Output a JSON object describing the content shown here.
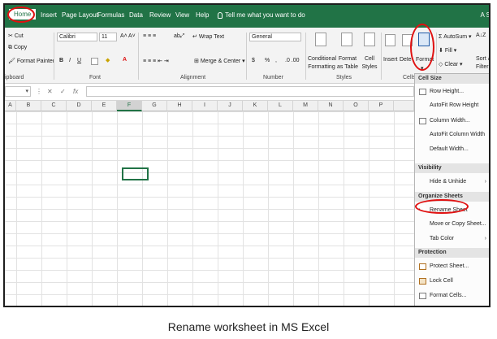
{
  "tabs": [
    {
      "label": "Home"
    },
    {
      "label": "Insert"
    },
    {
      "label": "Page Layout"
    },
    {
      "label": "Formulas"
    },
    {
      "label": "Data"
    },
    {
      "label": "Review"
    },
    {
      "label": "View"
    },
    {
      "label": "Help"
    }
  ],
  "tell_me": "Tell me what you want to do",
  "user": "A S",
  "clipboard": {
    "cut": "Cut",
    "copy": "Copy",
    "format_painter": "Format Painter",
    "group": "ipboard"
  },
  "font": {
    "name": "Calibri",
    "size": "11",
    "inc": "A˄",
    "dec": "A˅",
    "bold": "B",
    "italic": "I",
    "underline": "U",
    "group": "Font"
  },
  "alignment": {
    "wrap": "Wrap Text",
    "merge": "Merge & Center",
    "group": "Alignment"
  },
  "number": {
    "format": "General",
    "currency": "$",
    "percent": "%",
    "comma": ",",
    "group": "Number"
  },
  "styles": {
    "conditional": "Conditional Formatting",
    "format_as_table": "Format as Table",
    "cell_styles": "Cell Styles",
    "group": "Styles"
  },
  "cells": {
    "insert": "Insert",
    "delete": "Delete",
    "format": "Format",
    "group": "Cells"
  },
  "editing": {
    "autosum": "AutoSum",
    "fill": "Fill",
    "clear": "Clear",
    "sort": "Sort & Filter"
  },
  "formula": {
    "cancel": "✕",
    "enter": "✓",
    "fx": "fx"
  },
  "columns": [
    "A",
    "B",
    "C",
    "D",
    "E",
    "F",
    "G",
    "H",
    "I",
    "J",
    "K",
    "L",
    "M",
    "N",
    "O",
    "P"
  ],
  "selected_column": "F",
  "format_menu": {
    "sections": [
      {
        "header": "Cell Size",
        "items": [
          {
            "label": "Row Height..."
          },
          {
            "label": "AutoFit Row Height"
          },
          {
            "label": "Column Width..."
          },
          {
            "label": "AutoFit Column Width"
          },
          {
            "label": "Default Width..."
          }
        ]
      },
      {
        "header": "Visibility",
        "items": [
          {
            "label": "Hide & Unhide",
            "submenu": true
          }
        ]
      },
      {
        "header": "Organize Sheets",
        "items": [
          {
            "label": "Rename Sheet"
          },
          {
            "label": "Move or Copy Sheet..."
          },
          {
            "label": "Tab Color",
            "submenu": true
          }
        ]
      },
      {
        "header": "Protection",
        "items": [
          {
            "label": "Protect Sheet..."
          },
          {
            "label": "Lock Cell"
          },
          {
            "label": "Format Cells..."
          }
        ]
      }
    ]
  },
  "caption": "Rename worksheet in MS Excel",
  "colors": {
    "ribbon_green": "#217346",
    "highlight_red": "#e01010"
  }
}
